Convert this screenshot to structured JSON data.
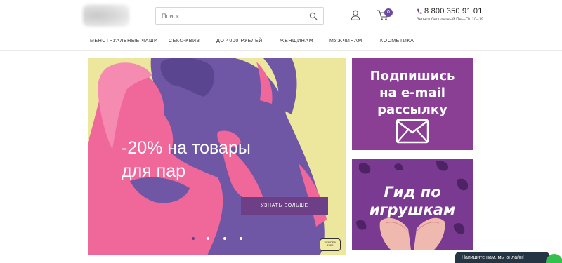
{
  "header": {
    "search_placeholder": "Поиск",
    "cart_count": "0",
    "phone": "8 800 350 91 01",
    "phone_note": "Звонок бесплатный Пн—Пт 10–19"
  },
  "nav": {
    "items": [
      {
        "label": "МЕНСТРУАЛЬНЫЕ ЧАШИ"
      },
      {
        "label": "СЕКС-КВИЗ"
      },
      {
        "label": "ДО 4000 РУБЛЕЙ"
      },
      {
        "label": "ЖЕНЩИНАМ"
      },
      {
        "label": "МУЖЧИНАМ"
      },
      {
        "label": "КОСМЕТИКА"
      }
    ]
  },
  "hero": {
    "title_line1": "-20% на товары",
    "title_line2": "для пар",
    "button_label": "УЗНАТЬ БОЛЬШЕ",
    "slide_count": 4,
    "active_slide": 1,
    "signature_line1": "VERDEN",
    "signature_line2": "2020"
  },
  "promo_subscribe": {
    "line1": "Подпишись",
    "line2": "на e-mail",
    "line3": "рассылку"
  },
  "promo_guide": {
    "line1": "Гид по",
    "line2": "игрушкам"
  },
  "chat": {
    "label": "Напишите нам, мы онлайн!"
  },
  "colors": {
    "brand_purple": "#6d3f87",
    "panel_purple": "#8a3f95",
    "hero_pink": "#f0679a",
    "hero_violet": "#6f57a6",
    "hero_yellow": "#ede79e",
    "chat_dark": "#263543",
    "chat_green": "#35c04e"
  }
}
